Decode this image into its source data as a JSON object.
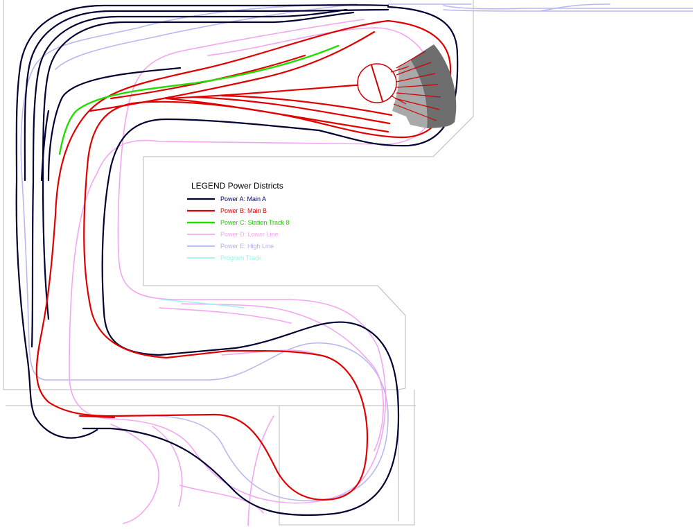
{
  "legend": {
    "title": "LEGEND Power Districts",
    "items": [
      {
        "label": "Power A: Main A",
        "color": "#000033"
      },
      {
        "label": "Power B: Main B",
        "color": "#e00000"
      },
      {
        "label": "Power C: Station Track 8",
        "color": "#22dd00"
      },
      {
        "label": "Power D: Lower Line",
        "color": "#f3a6f0"
      },
      {
        "label": "Power E: High Line",
        "color": "#b8b8ef"
      },
      {
        "label": "Program Track",
        "color": "#a0f0f0"
      }
    ]
  },
  "colors": {
    "wall": "#b8b8b8",
    "turntable": "#cc0000",
    "roundhouse_dark": "#6e6e6e",
    "roundhouse_light": "#a9a9a9"
  }
}
